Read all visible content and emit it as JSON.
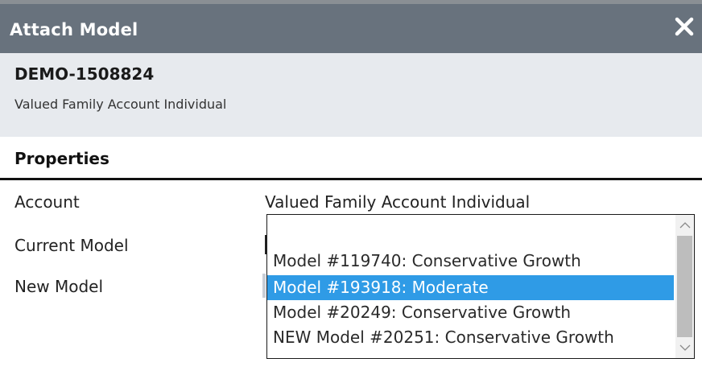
{
  "dialog": {
    "title": "Attach Model",
    "close_icon": "close-icon"
  },
  "header": {
    "account_id": "DEMO-1508824",
    "account_name": "Valued Family Account Individual"
  },
  "properties": {
    "section_title": "Properties",
    "account_label": "Account",
    "account_value": "Valued Family Account Individual",
    "current_model_label": "Current Model",
    "new_model_label": "New Model"
  },
  "model_select": {
    "options": [
      "",
      "Model #119740: Conservative Growth",
      "Model #193918: Moderate",
      "Model #20249: Conservative Growth",
      "NEW Model #20251: Conservative Growth"
    ],
    "selected_index": 2,
    "scroll_up_icon": "chevron-up-icon",
    "scroll_down_icon": "chevron-down-icon"
  },
  "colors": {
    "titlebar": "#68727d",
    "header_bg": "#e7eaee",
    "selection": "#2f9be6"
  }
}
